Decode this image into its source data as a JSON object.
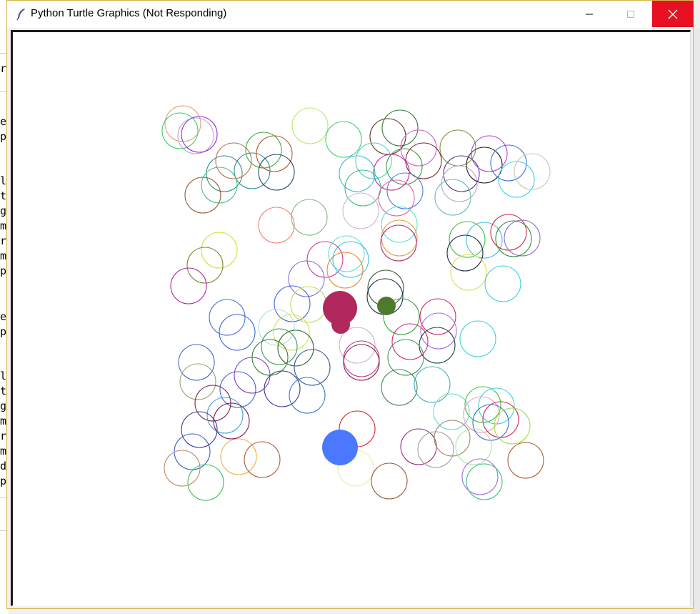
{
  "window": {
    "title": "Python Turtle Graphics (Not Responding)",
    "controls": {
      "minimize": "minimize",
      "maximize": "maximize",
      "close": "close"
    }
  },
  "background_editor": {
    "visible_chars": [
      "r",
      "e",
      "p",
      "l",
      "t",
      "g",
      "m",
      "r",
      "m",
      "p",
      "e",
      "p",
      "l",
      "t",
      "g",
      "m",
      "r",
      "m",
      "d",
      "p"
    ]
  },
  "turtles": [
    {
      "name": "magenta-turtle",
      "color": "#b0285e"
    },
    {
      "name": "green-turtle",
      "color": "#4f7a2e"
    },
    {
      "name": "blue-turtle",
      "color": "#4a78ff"
    }
  ]
}
